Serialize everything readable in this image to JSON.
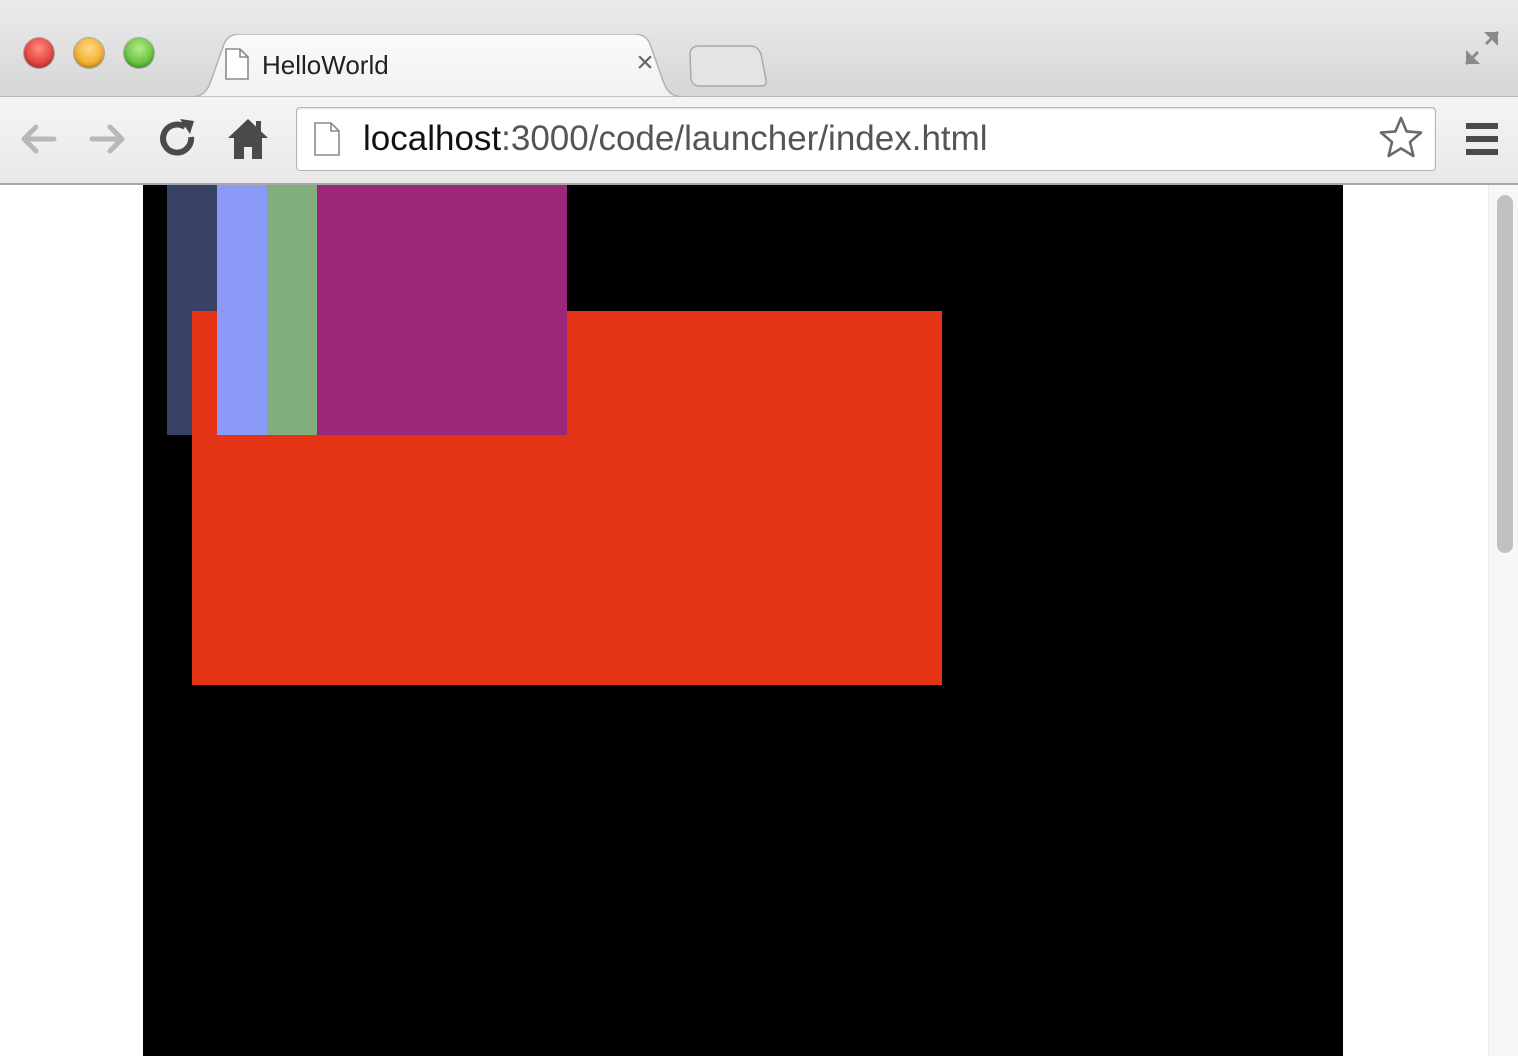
{
  "browser": {
    "tab": {
      "title": "HelloWorld",
      "close_glyph": "×"
    },
    "address_bar": {
      "host": "localhost",
      "rest": ":3000/code/launcher/index.html"
    },
    "icons": {
      "back": "arrow-left-icon",
      "forward": "arrow-right-icon",
      "reload": "reload-icon",
      "home": "home-icon",
      "page": "document-icon",
      "bookmark": "star-icon",
      "menu": "hamburger-menu-icon",
      "fullscreen": "fullscreen-icon"
    }
  },
  "canvas": {
    "background": "#000000",
    "shapes": [
      {
        "name": "navy-rectangle",
        "color": "#374266"
      },
      {
        "name": "periwinkle-rectangle",
        "color": "#8b99f7"
      },
      {
        "name": "green-rectangle",
        "color": "#82ae7e"
      },
      {
        "name": "magenta-rectangle",
        "color": "#9c267a"
      },
      {
        "name": "red-rectangle",
        "color": "#e53415"
      }
    ]
  }
}
